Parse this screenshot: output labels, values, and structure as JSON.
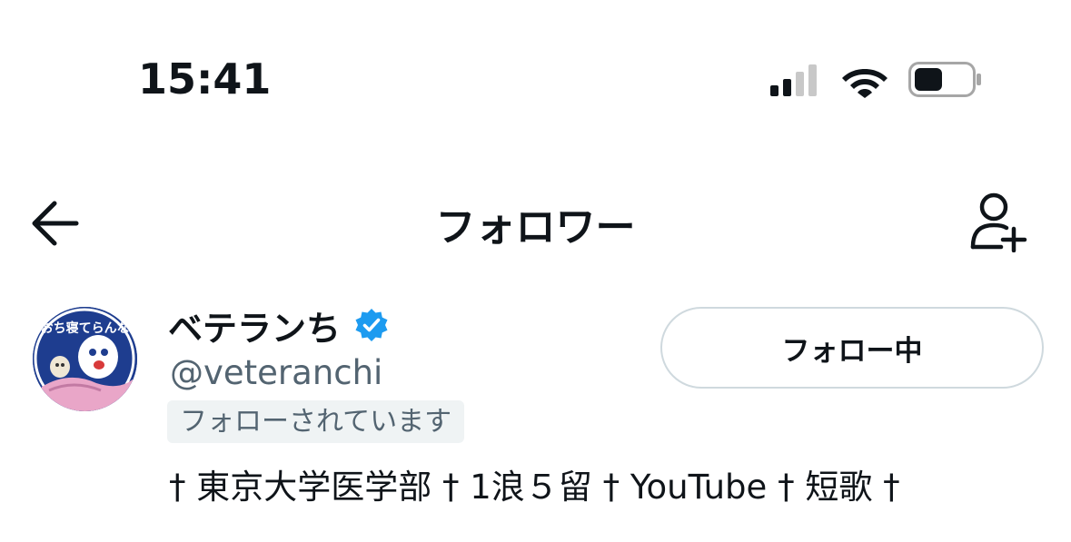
{
  "status_bar": {
    "time": "15:41",
    "signal_icon": "cellular-signal-icon",
    "wifi_icon": "wifi-icon",
    "battery_icon": "battery-icon"
  },
  "header": {
    "back_icon": "arrow-left-icon",
    "title": "フォロワー",
    "add_user_icon": "person-add-icon"
  },
  "user": {
    "display_name": "ベテランち",
    "verified_icon": "verified-badge-icon",
    "handle": "@veteranchi",
    "follows_you": "フォローされています",
    "bio": "† 東京大学医学部 † 1浪５留 † YouTube † 短歌 †",
    "follow_button_label": "フォロー中",
    "avatar_text": "ぶちおち寝てらんない!!"
  },
  "colors": {
    "text": "#0f1419",
    "secondary": "#536471",
    "verified": "#1d9bf0",
    "badge_bg": "#eff3f4",
    "button_border": "#cfd9de"
  }
}
